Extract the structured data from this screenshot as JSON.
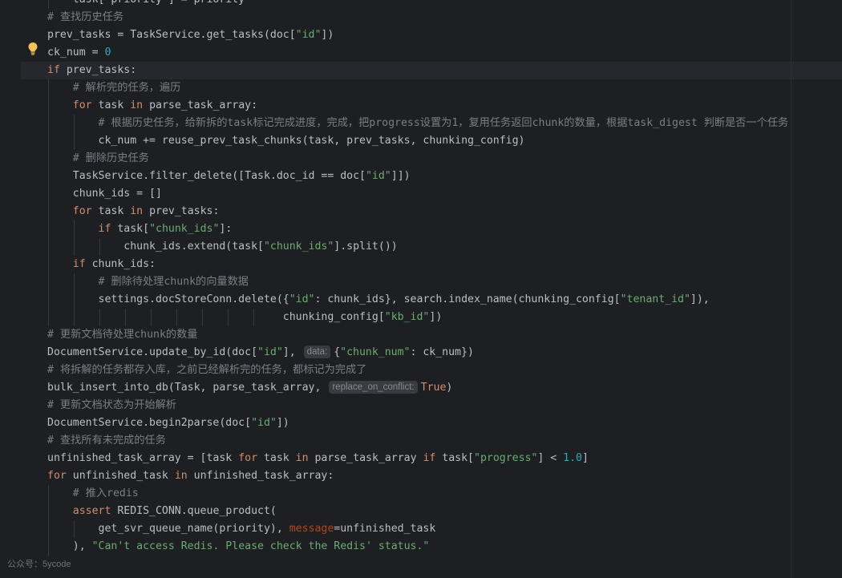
{
  "editor": {
    "lines": [
      {
        "code": [
          {
            "t": "    task[\"priority\"] = priority",
            "c": ""
          }
        ]
      },
      {
        "code": [
          {
            "t": "# 查找历史任务",
            "c": "cm"
          }
        ]
      },
      {
        "code": [
          {
            "t": "prev_tasks = TaskService.get_tasks(doc[",
            "c": ""
          },
          {
            "t": "\"id\"",
            "c": "str"
          },
          {
            "t": "])",
            "c": ""
          }
        ]
      },
      {
        "code": [
          {
            "t": "ck_num = ",
            "c": ""
          },
          {
            "t": "0",
            "c": "num"
          }
        ]
      },
      {
        "code": [
          {
            "t": "if",
            "c": "kw"
          },
          {
            "t": " prev_tasks:",
            "c": ""
          }
        ]
      },
      {
        "code": [
          {
            "t": "    # 解析完的任务，遍历",
            "c": "cm"
          }
        ]
      },
      {
        "code": [
          {
            "t": "    ",
            "c": ""
          },
          {
            "t": "for",
            "c": "kw"
          },
          {
            "t": " task ",
            "c": ""
          },
          {
            "t": "in",
            "c": "kw"
          },
          {
            "t": " parse_task_array:",
            "c": ""
          }
        ]
      },
      {
        "code": [
          {
            "t": "        # 根据历史任务，给新拆的task标记完成进度，完成，把progress设置为1，复用任务返回chunk的数量，根据task_digest 判断是否一个任务",
            "c": "cm"
          }
        ]
      },
      {
        "code": [
          {
            "t": "        ck_num += reuse_prev_task_chunks(task, prev_tasks, chunking_config)",
            "c": ""
          }
        ]
      },
      {
        "code": [
          {
            "t": "    # 删除历史任务",
            "c": "cm"
          }
        ]
      },
      {
        "code": [
          {
            "t": "    TaskService.filter_delete([Task.doc_id == doc[",
            "c": ""
          },
          {
            "t": "\"id\"",
            "c": "str"
          },
          {
            "t": "]])",
            "c": ""
          }
        ]
      },
      {
        "code": [
          {
            "t": "    chunk_ids = []",
            "c": ""
          }
        ]
      },
      {
        "code": [
          {
            "t": "    ",
            "c": ""
          },
          {
            "t": "for",
            "c": "kw"
          },
          {
            "t": " task ",
            "c": ""
          },
          {
            "t": "in",
            "c": "kw"
          },
          {
            "t": " prev_tasks:",
            "c": ""
          }
        ]
      },
      {
        "code": [
          {
            "t": "        ",
            "c": ""
          },
          {
            "t": "if",
            "c": "kw"
          },
          {
            "t": " task[",
            "c": ""
          },
          {
            "t": "\"chunk_ids\"",
            "c": "str"
          },
          {
            "t": "]:",
            "c": ""
          }
        ]
      },
      {
        "code": [
          {
            "t": "            chunk_ids.extend(task[",
            "c": ""
          },
          {
            "t": "\"chunk_ids\"",
            "c": "str"
          },
          {
            "t": "].split())",
            "c": ""
          }
        ]
      },
      {
        "code": [
          {
            "t": "    ",
            "c": ""
          },
          {
            "t": "if",
            "c": "kw"
          },
          {
            "t": " chunk_ids:",
            "c": ""
          }
        ]
      },
      {
        "code": [
          {
            "t": "        # 删除待处理chunk的向量数据",
            "c": "cm"
          }
        ]
      },
      {
        "code": [
          {
            "t": "        settings.docStoreConn.delete({",
            "c": ""
          },
          {
            "t": "\"id\"",
            "c": "str"
          },
          {
            "t": ": chunk_ids}, search.index_name(chunking_config[",
            "c": ""
          },
          {
            "t": "\"tenant_id\"",
            "c": "str"
          },
          {
            "t": "]),",
            "c": ""
          }
        ]
      },
      {
        "code": [
          {
            "t": "                                     chunking_config[",
            "c": ""
          },
          {
            "t": "\"kb_id\"",
            "c": "str"
          },
          {
            "t": "])",
            "c": ""
          }
        ]
      },
      {
        "code": [
          {
            "t": "# 更新文档待处理chunk的数量",
            "c": "cm"
          }
        ]
      },
      {
        "code": [
          {
            "t": "DocumentService.update_by_id(doc[",
            "c": ""
          },
          {
            "t": "\"id\"",
            "c": "str"
          },
          {
            "t": "], ",
            "c": ""
          },
          {
            "t": "data:",
            "c": "hint"
          },
          {
            "t": "{",
            "c": ""
          },
          {
            "t": "\"chunk_num\"",
            "c": "str"
          },
          {
            "t": ": ck_num})",
            "c": ""
          }
        ]
      },
      {
        "code": [
          {
            "t": "# 将拆解的任务都存入库，之前已经解析完的任务，都标记为完成了",
            "c": "cm"
          }
        ]
      },
      {
        "code": [
          {
            "t": "bulk_insert_into_db(Task, parse_task_array, ",
            "c": ""
          },
          {
            "t": "replace_on_conflict:",
            "c": "hint"
          },
          {
            "t": "True",
            "c": "kw"
          },
          {
            "t": ")",
            "c": ""
          }
        ]
      },
      {
        "code": [
          {
            "t": "# 更新文档状态为开始解析",
            "c": "cm"
          }
        ]
      },
      {
        "code": [
          {
            "t": "DocumentService.begin2parse(doc[",
            "c": ""
          },
          {
            "t": "\"id\"",
            "c": "str"
          },
          {
            "t": "])",
            "c": ""
          }
        ]
      },
      {
        "code": [
          {
            "t": "# 查找所有未完成的任务",
            "c": "cm"
          }
        ]
      },
      {
        "code": [
          {
            "t": "unfinished_task_array = [task ",
            "c": ""
          },
          {
            "t": "for",
            "c": "kw"
          },
          {
            "t": " task ",
            "c": ""
          },
          {
            "t": "in",
            "c": "kw"
          },
          {
            "t": " parse_task_array ",
            "c": ""
          },
          {
            "t": "if",
            "c": "kw"
          },
          {
            "t": " task[",
            "c": ""
          },
          {
            "t": "\"progress\"",
            "c": "str"
          },
          {
            "t": "] < ",
            "c": ""
          },
          {
            "t": "1.0",
            "c": "num"
          },
          {
            "t": "]",
            "c": ""
          }
        ]
      },
      {
        "code": [
          {
            "t": "for",
            "c": "kw"
          },
          {
            "t": " unfinished_task ",
            "c": ""
          },
          {
            "t": "in",
            "c": "kw"
          },
          {
            "t": " unfinished_task_array:",
            "c": ""
          }
        ]
      },
      {
        "code": [
          {
            "t": "    # 推入redis",
            "c": "cm"
          }
        ]
      },
      {
        "code": [
          {
            "t": "    ",
            "c": ""
          },
          {
            "t": "assert",
            "c": "kw"
          },
          {
            "t": " REDIS_CONN.queue_product(",
            "c": ""
          }
        ]
      },
      {
        "code": [
          {
            "t": "        get_svr_queue_name(priority), ",
            "c": ""
          },
          {
            "t": "message",
            "c": "param"
          },
          {
            "t": "=unfinished_task",
            "c": ""
          }
        ]
      },
      {
        "code": [
          {
            "t": "    ), ",
            "c": ""
          },
          {
            "t": "\"Can't access Redis. Please check the Redis' status.\"",
            "c": "str"
          }
        ]
      }
    ]
  },
  "watermark": "公众号：5ycode",
  "colors": {
    "background": "#1e1f22",
    "keyword": "#cf8e6d",
    "string": "#6aab73",
    "number": "#2aacb8",
    "comment": "#7a7e85",
    "bulb": "#f2c55c"
  }
}
